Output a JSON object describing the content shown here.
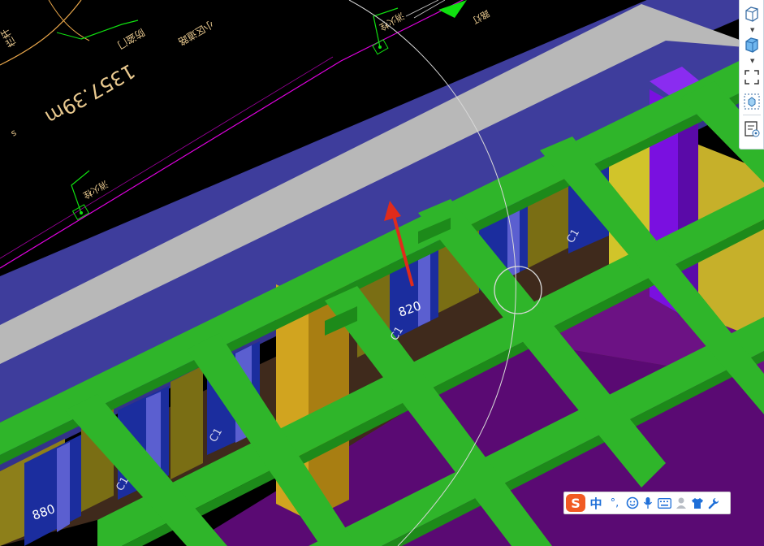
{
  "drawing": {
    "area_text": "1357.39m",
    "small_text": "s",
    "labels": {
      "top_left_tag": "栏杆",
      "top_door_tag": "防盗门",
      "top_road_tag": "小区道路",
      "mid_tag": "消火栓",
      "lower_tag": "消火栓",
      "right_tag": "路灯"
    },
    "window_codes": {
      "code_a": "C1",
      "code_b": "C1",
      "code_c": "C1",
      "code_d": "C1"
    },
    "dimensions": {
      "dim_center": "820",
      "dim_left": "880"
    }
  },
  "view_toolbar": {
    "items": [
      {
        "name": "3d-box-icon"
      },
      {
        "name": "3d-box-blue-icon"
      },
      {
        "name": "fit-view-icon"
      },
      {
        "name": "orbit-view-icon"
      },
      {
        "name": "view-settings-icon"
      }
    ]
  },
  "ime_toolbar": {
    "logo": "S",
    "language": "中",
    "punctuation": "°,",
    "icons": [
      "emoji-icon",
      "microphone-icon",
      "keyboard-icon",
      "user-icon",
      "skin-icon",
      "tools-icon"
    ]
  },
  "colors": {
    "background": "#000000",
    "beam_green": "#2fb52a",
    "wall_blue": "#3e3d9c",
    "slab_gray": "#b8b8b8",
    "floor_purple": "#5a0a73",
    "column_yellow": "#d1a41f",
    "column_purple": "#7a10e0",
    "wall_brown": "#3f2a1c",
    "window_blue": "#1b2d9e",
    "arrow_red": "#e02b1b",
    "cad_magenta": "#e000e0",
    "cad_green": "#10e010",
    "cad_text": "#e9c98f",
    "ime_orange": "#f15a22",
    "ime_blue": "#1e6fd8"
  }
}
